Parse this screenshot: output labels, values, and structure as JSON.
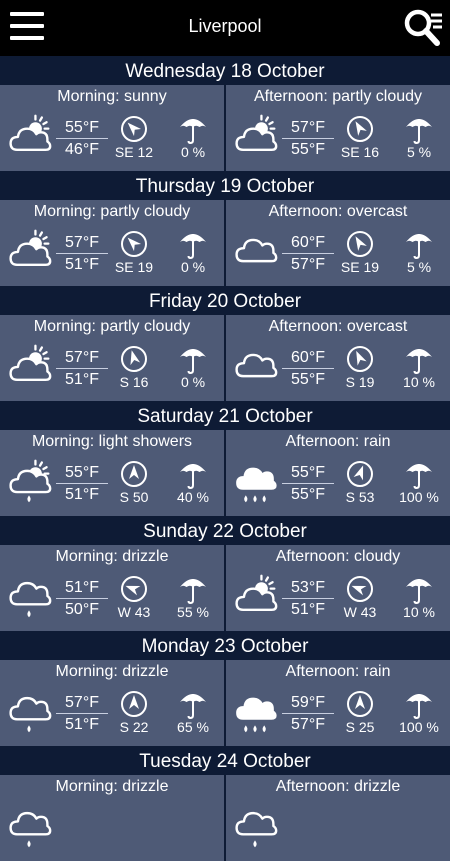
{
  "app": {
    "title": "Liverpool"
  },
  "icons": {
    "menu": "hamburger-menu-icon",
    "search": "search-list-icon",
    "wind": "wind-direction-arrow-icon",
    "precipitation": "umbrella-icon"
  },
  "colors": {
    "background": "#0e1b35",
    "panel": "#4e5a76",
    "topbar": "#000000",
    "text": "#ffffff"
  },
  "days": [
    {
      "date": "Wednesday 18 October",
      "morning": {
        "label": "Morning: sunny",
        "icon": "sunny-cloud-icon",
        "temp_high": "55°F",
        "temp_low": "46°F",
        "wind": "SE 12",
        "wind_deg": 315,
        "precip": "0 %"
      },
      "afternoon": {
        "label": "Afternoon: partly cloudy",
        "icon": "sun-behind-cloud-icon",
        "temp_high": "57°F",
        "temp_low": "55°F",
        "wind": "SE 16",
        "wind_deg": 330,
        "precip": "5 %"
      }
    },
    {
      "date": "Thursday 19 October",
      "morning": {
        "label": "Morning: partly cloudy",
        "icon": "sun-behind-cloud-icon",
        "temp_high": "57°F",
        "temp_low": "51°F",
        "wind": "SE 19",
        "wind_deg": 315,
        "precip": "0 %"
      },
      "afternoon": {
        "label": "Afternoon: overcast",
        "icon": "cloud-icon",
        "temp_high": "60°F",
        "temp_low": "57°F",
        "wind": "SE 19",
        "wind_deg": 330,
        "precip": "5 %"
      }
    },
    {
      "date": "Friday 20 October",
      "morning": {
        "label": "Morning: partly cloudy",
        "icon": "sun-behind-cloud-icon",
        "temp_high": "57°F",
        "temp_low": "51°F",
        "wind": "S 16",
        "wind_deg": 345,
        "precip": "0 %"
      },
      "afternoon": {
        "label": "Afternoon: overcast",
        "icon": "cloud-icon",
        "temp_high": "60°F",
        "temp_low": "55°F",
        "wind": "S 19",
        "wind_deg": 335,
        "precip": "10 %"
      }
    },
    {
      "date": "Saturday 21 October",
      "morning": {
        "label": "Morning: light showers",
        "icon": "sun-cloud-rain-icon",
        "temp_high": "55°F",
        "temp_low": "51°F",
        "wind": "S 50",
        "wind_deg": 0,
        "precip": "40 %"
      },
      "afternoon": {
        "label": "Afternoon: rain",
        "icon": "rain-cloud-icon",
        "temp_high": "55°F",
        "temp_low": "55°F",
        "wind": "S 53",
        "wind_deg": 20,
        "precip": "100 %"
      }
    },
    {
      "date": "Sunday 22 October",
      "morning": {
        "label": "Morning: drizzle",
        "icon": "cloud-drizzle-icon",
        "temp_high": "51°F",
        "temp_low": "50°F",
        "wind": "W 43",
        "wind_deg": 290,
        "precip": "55 %"
      },
      "afternoon": {
        "label": "Afternoon: cloudy",
        "icon": "sun-behind-cloud-icon",
        "temp_high": "53°F",
        "temp_low": "51°F",
        "wind": "W 43",
        "wind_deg": 290,
        "precip": "10 %"
      }
    },
    {
      "date": "Monday 23 October",
      "morning": {
        "label": "Morning: drizzle",
        "icon": "cloud-drizzle-icon",
        "temp_high": "57°F",
        "temp_low": "51°F",
        "wind": "S 22",
        "wind_deg": 0,
        "precip": "65 %"
      },
      "afternoon": {
        "label": "Afternoon: rain",
        "icon": "rain-cloud-icon",
        "temp_high": "59°F",
        "temp_low": "57°F",
        "wind": "S 25",
        "wind_deg": 0,
        "precip": "100 %"
      }
    },
    {
      "date": "Tuesday 24 October",
      "morning": {
        "label": "Morning: drizzle",
        "icon": "cloud-drizzle-icon",
        "temp_high": "",
        "temp_low": "",
        "wind": "",
        "wind_deg": 0,
        "precip": ""
      },
      "afternoon": {
        "label": "Afternoon: drizzle",
        "icon": "cloud-drizzle-icon",
        "temp_high": "",
        "temp_low": "",
        "wind": "",
        "wind_deg": 0,
        "precip": ""
      }
    }
  ]
}
